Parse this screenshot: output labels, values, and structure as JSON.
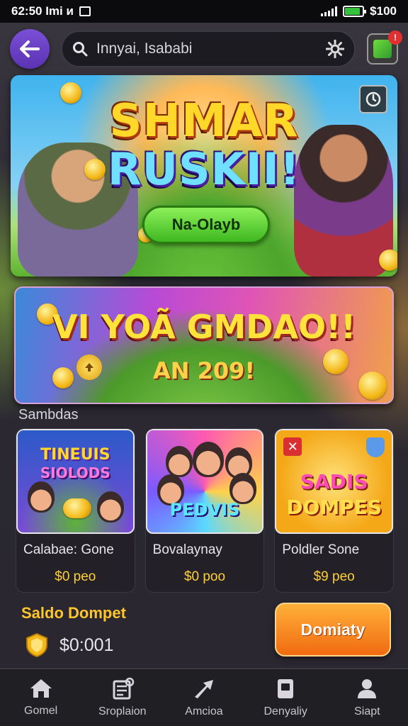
{
  "status_bar": {
    "time": "62:50 Imi и",
    "battery_text": "$100",
    "battery_level": 0.85
  },
  "header": {
    "search_value": "Innyai, Isababi"
  },
  "hero": {
    "title_line1": "SHMAR",
    "title_line2": "RUSKII!",
    "play_label": "Na-Olayb"
  },
  "promo": {
    "title": "VI YOÃ GMDAO!!",
    "subtitle": "AN 209!"
  },
  "section": {
    "label": "Sambdas"
  },
  "games": [
    {
      "name": "Calabae: Gone",
      "price": "$0 peo",
      "thumb_line1": "TINEUIS",
      "thumb_line2": "SIOLODS"
    },
    {
      "name": "Bovalaynay",
      "price": "$0 poo",
      "thumb_line1": "PEDVIS",
      "thumb_line2": ""
    },
    {
      "name": "Poldler Sone",
      "price": "$9 peo",
      "thumb_line1": "SADIS",
      "thumb_line2": "DOMPES"
    }
  ],
  "wallet": {
    "title": "Saldo Dompet",
    "balance": "$0:001",
    "cta_label": "Domiaty"
  },
  "nav": [
    {
      "label": "Gomel",
      "icon": "home-icon"
    },
    {
      "label": "Sroplaion",
      "icon": "shop-icon"
    },
    {
      "label": "Amcioa",
      "icon": "action-icon"
    },
    {
      "label": "Denyaliy",
      "icon": "deposit-icon"
    },
    {
      "label": "Siapt",
      "icon": "profile-icon"
    }
  ],
  "colors": {
    "accent_purple": "#6a40c8",
    "accent_orange": "#f58a20",
    "price_gold": "#ffcf3a",
    "wallet_gold": "#ffc62a",
    "play_green": "#4fc828"
  }
}
